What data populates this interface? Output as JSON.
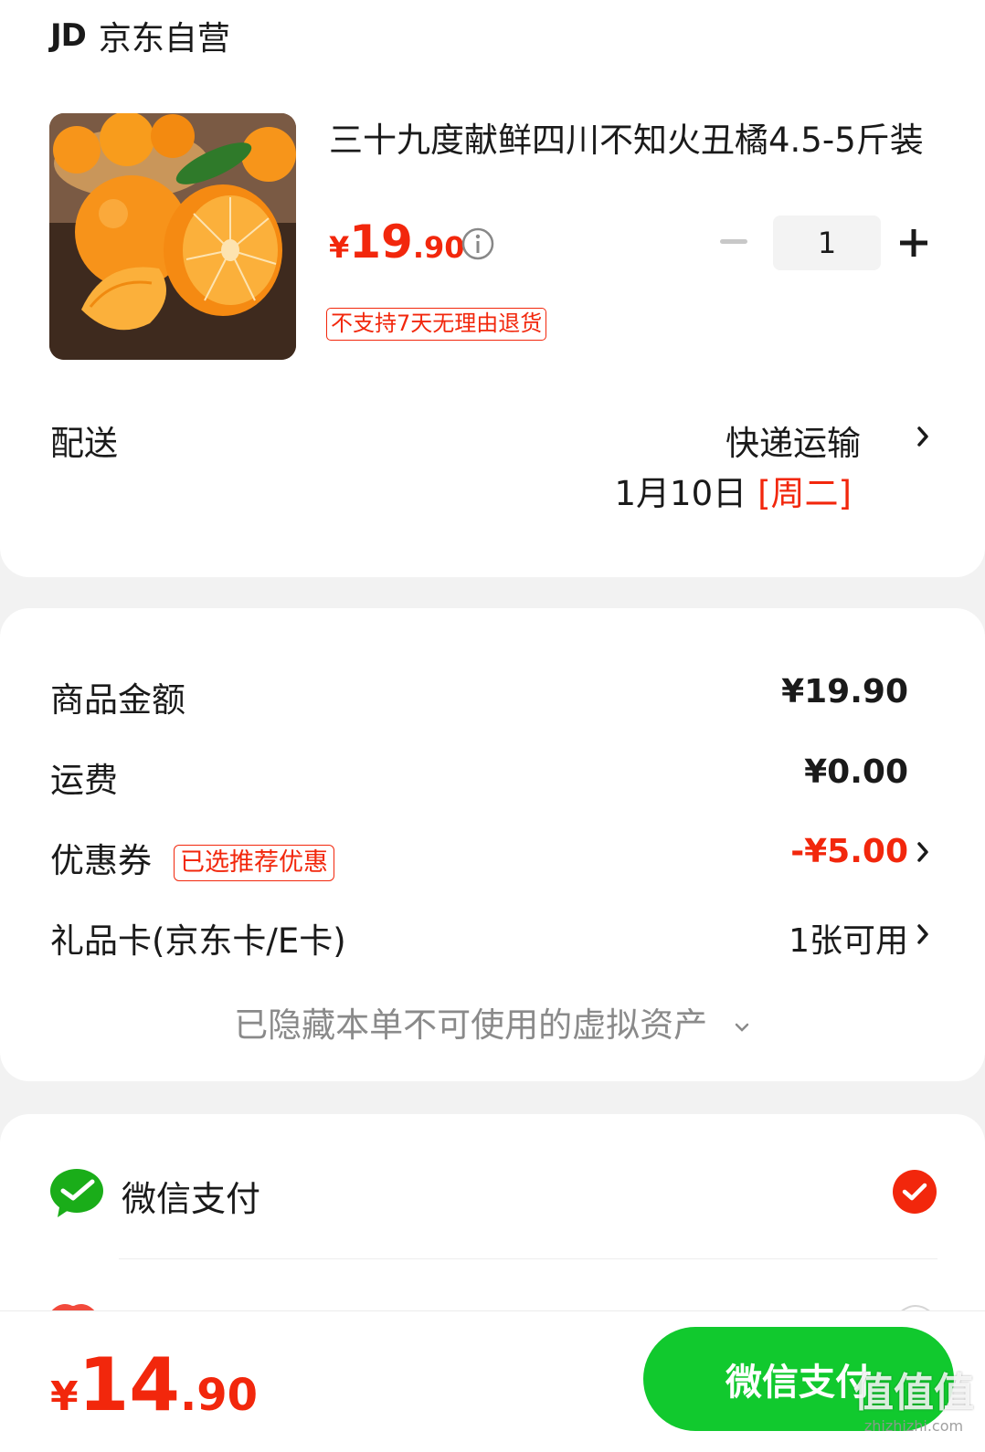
{
  "shop": {
    "logo": "JD",
    "name": "京东自营"
  },
  "product": {
    "title": "三十九度献鲜四川不知火丑橘4.5-5斤装",
    "price_symbol": "¥",
    "price_int": "19",
    "price_dec": ".90",
    "quantity": "1",
    "return_tag": "不支持7天无理由退货",
    "image": "orange-product-photo"
  },
  "delivery": {
    "label": "配送",
    "method": "快递运输",
    "date": "1月10日",
    "weekday": "[周二]"
  },
  "amounts": {
    "goods_label": "商品金额",
    "goods_value": "¥19.90",
    "shipping_label": "运费",
    "shipping_value": "¥0.00",
    "coupon_label": "优惠券",
    "coupon_tag": "已选推荐优惠",
    "coupon_value": "-¥5.00",
    "giftcard_label": "礼品卡(京东卡/E卡)",
    "giftcard_value": "1张可用",
    "hidden_assets": "已隐藏本单不可使用的虚拟资产"
  },
  "payment": {
    "method_label": "微信支付",
    "selected": true,
    "icon": "wechat-pay-icon"
  },
  "footer": {
    "total_symbol": "¥",
    "total_int": "14",
    "total_dec": ".90",
    "pay_button": "微信支付"
  },
  "watermark": {
    "text": "值值值",
    "url": "zhizhizhi.com"
  },
  "colors": {
    "accent_red": "#f2270c",
    "pay_green": "#11c92e",
    "page_bg": "#f2f2f2"
  }
}
